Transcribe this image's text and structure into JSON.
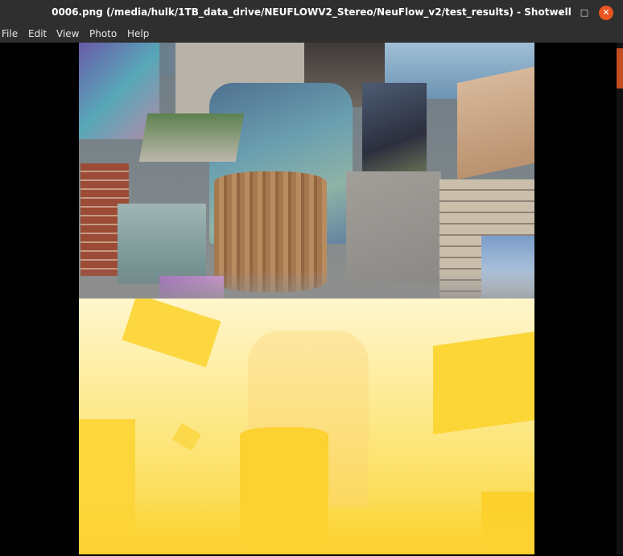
{
  "window": {
    "title": "0006.png (/media/hulk/1TB_data_drive/NEUFLOWV2_Stereo/NeuFlow_v2/test_results) - Shotwell",
    "minimize_glyph": "–",
    "maximize_glyph": "□",
    "close_glyph": "✕"
  },
  "menu": {
    "items": [
      "File",
      "Edit",
      "View",
      "Photo",
      "Help"
    ]
  },
  "colors": {
    "titlebar": "#2f2f2f",
    "close_button": "#e95420",
    "viewer_background": "#000000",
    "disparity_light": "#fff6cc",
    "disparity_dark": "#fcd637"
  },
  "image": {
    "icon": "photo-image",
    "panels": [
      "rendered-scene",
      "disparity-map"
    ]
  }
}
